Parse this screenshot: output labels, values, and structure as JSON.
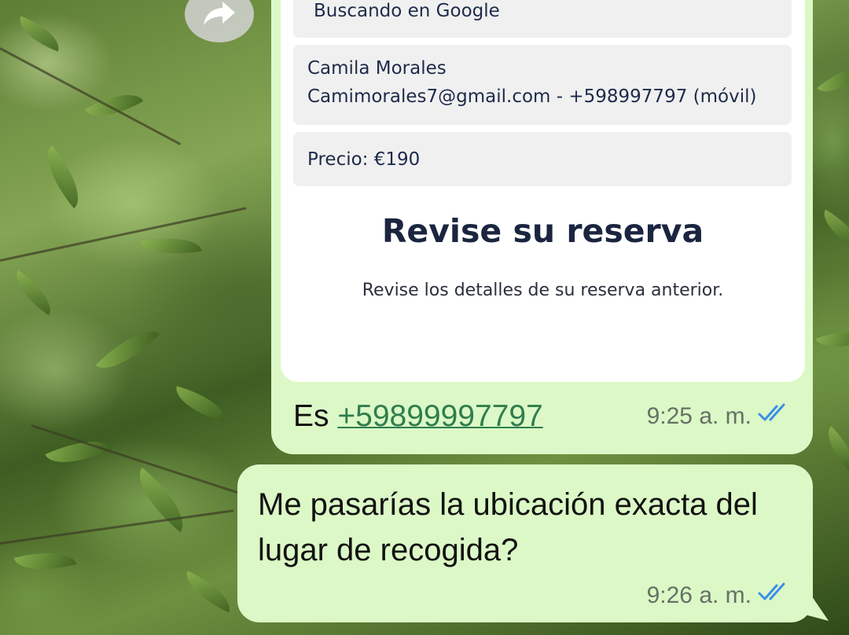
{
  "forward_button": {
    "icon": "forward-arrow-icon"
  },
  "booking_card": {
    "search_status": "Buscando en Google",
    "contact_name": "Camila Morales",
    "contact_details": "Camimorales7@gmail.com - +598997797 (móvil)",
    "price": "Precio:  €190",
    "title": "Revise su reserva",
    "subtitle": "Revise los detalles de su reserva anterior."
  },
  "messages": [
    {
      "prefix": "Es ",
      "phone_link": "+59899997797",
      "time": "9:25 a. m.",
      "status_icon": "double-check-read-icon"
    },
    {
      "text": "Me pasarías la ubicación exacta del lugar de recogida?",
      "time": "9:26 a. m.",
      "status_icon": "double-check-read-icon"
    }
  ],
  "colors": {
    "outgoing_bubble": "#dcf8c6",
    "link": "#2f7d4d",
    "read_ticks": "#3b8fe8"
  }
}
